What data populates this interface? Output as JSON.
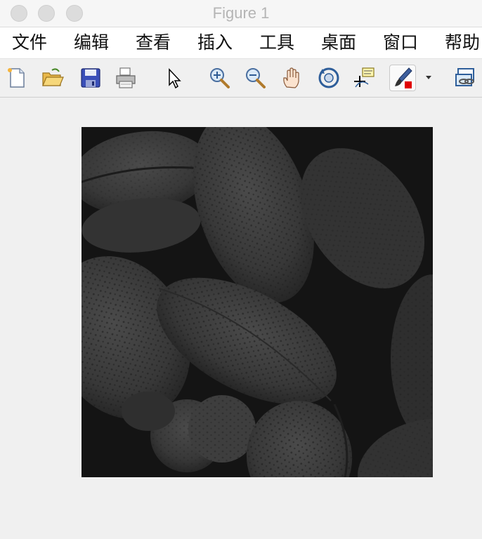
{
  "window": {
    "title": "Figure 1"
  },
  "menubar": {
    "items": [
      {
        "label": "文件"
      },
      {
        "label": "编辑"
      },
      {
        "label": "查看"
      },
      {
        "label": "插入"
      },
      {
        "label": "工具"
      },
      {
        "label": "桌面"
      },
      {
        "label": "窗口"
      },
      {
        "label": "帮助"
      }
    ]
  },
  "toolbar": {
    "buttons": [
      {
        "icon": "new-figure-icon"
      },
      {
        "icon": "open-file-icon"
      },
      {
        "icon": "save-icon"
      },
      {
        "icon": "print-icon"
      },
      {
        "icon": "edit-plot-icon"
      },
      {
        "icon": "zoom-in-icon"
      },
      {
        "icon": "zoom-out-icon"
      },
      {
        "icon": "pan-icon"
      },
      {
        "icon": "rotate-3d-icon"
      },
      {
        "icon": "data-cursor-icon"
      },
      {
        "icon": "brush-icon",
        "pressed": true
      },
      {
        "icon": "link-plot-icon"
      }
    ]
  },
  "figure": {
    "content": "grayscale-pollen-image"
  },
  "colors": {
    "window_bg": "#f0f0f0",
    "image_bg": "#141414",
    "title_text": "#b5b5b5"
  }
}
